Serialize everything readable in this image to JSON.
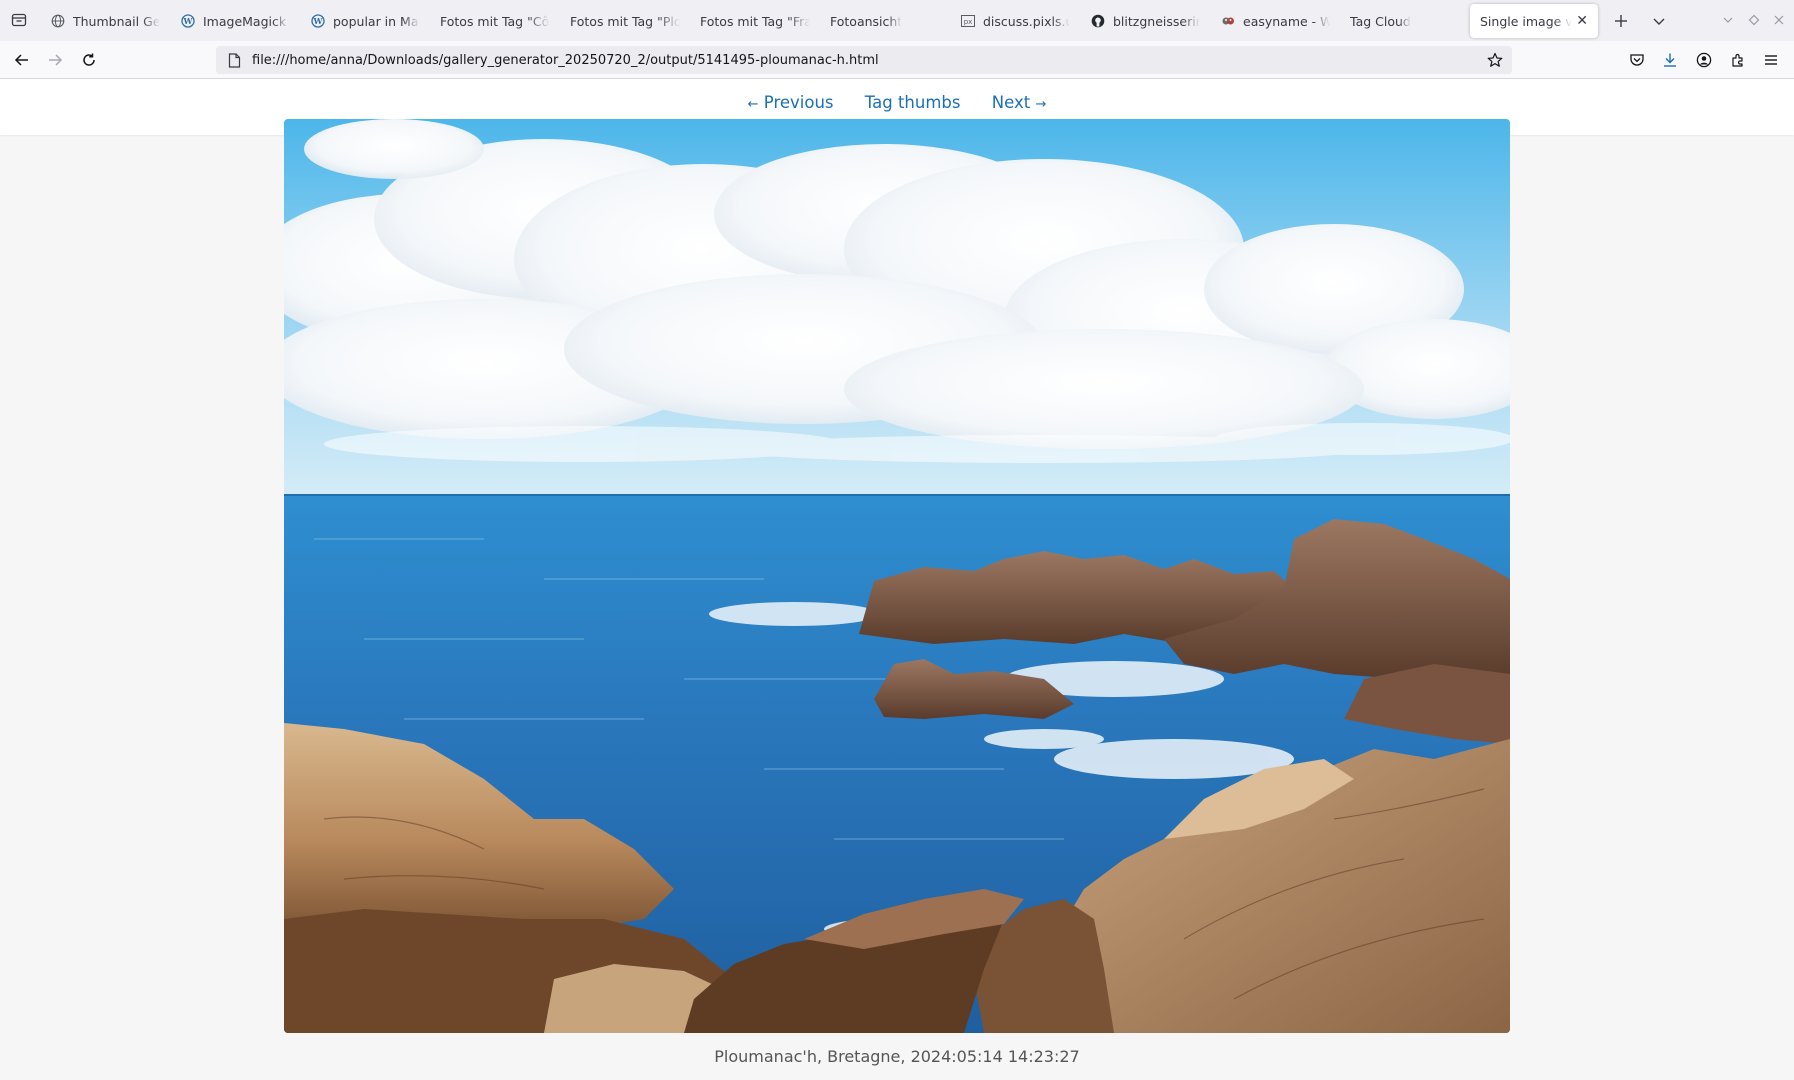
{
  "browser": {
    "tabs": [
      {
        "title": "Thumbnail Gen",
        "favicon": "globe-icon",
        "active": false
      },
      {
        "title": "ImageMagick E",
        "favicon": "wordpress-icon",
        "active": false
      },
      {
        "title": "popular in May",
        "favicon": "wordpress-icon",
        "active": false
      },
      {
        "title": "Fotos mit Tag \"Côt",
        "favicon": "",
        "active": false
      },
      {
        "title": "Fotos mit Tag \"Plo",
        "favicon": "",
        "active": false
      },
      {
        "title": "Fotos mit Tag \"Fran",
        "favicon": "",
        "active": false
      },
      {
        "title": "Fotoansicht",
        "favicon": "",
        "active": false
      },
      {
        "title": "discuss.pixls.us",
        "favicon": "pixls-icon",
        "active": false
      },
      {
        "title": "blitzgneisserin/",
        "favicon": "github-icon",
        "active": false
      },
      {
        "title": "easyname - We",
        "favicon": "easyname-icon",
        "active": false
      },
      {
        "title": "Tag Cloud",
        "favicon": "",
        "active": false
      },
      {
        "title": "Single image vie",
        "favicon": "",
        "active": true
      }
    ],
    "url": "file:///home/anna/Downloads/gallery_generator_20250720_2/output/5141495-ploumanac-h.html",
    "accent_color": "#1a6fb5"
  },
  "gallery": {
    "prev_label": "Previous",
    "prev_arrow": "←",
    "thumbs_label": "Tag thumbs",
    "next_label": "Next",
    "next_arrow": "→",
    "caption": "Ploumanac'h, Bretagne, 2024:05:14 14:23:27",
    "image_alt": "Ploumanac'h, Bretagne"
  }
}
